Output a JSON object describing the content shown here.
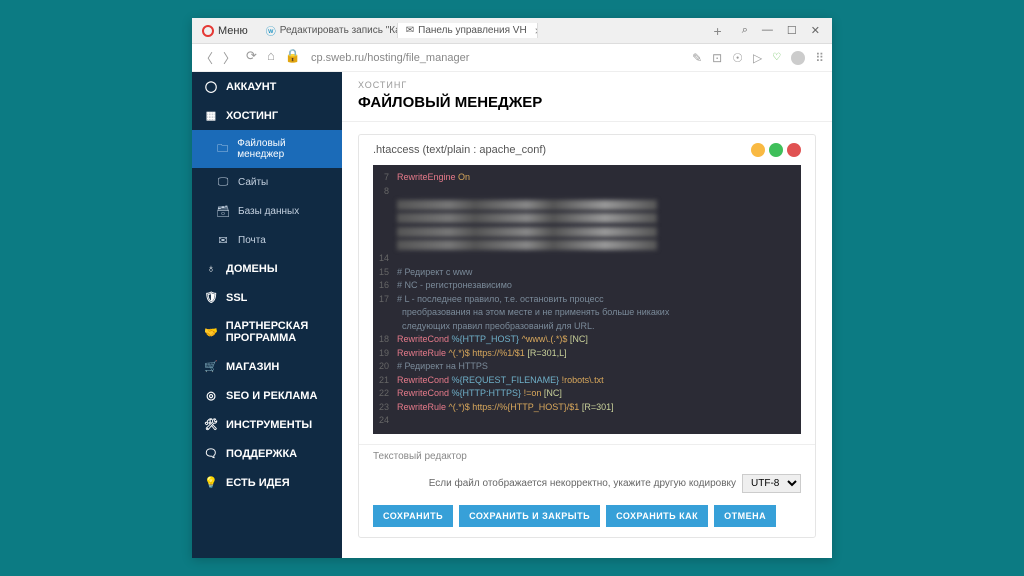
{
  "browser": {
    "menu_label": "Меню",
    "tabs": [
      {
        "label": "Редактировать запись \"Ка...",
        "icon": "wp",
        "active": false
      },
      {
        "label": "Панель управления VH",
        "icon": "mail",
        "active": true
      }
    ],
    "address": "cp.sweb.ru/hosting/file_manager"
  },
  "sidebar": {
    "items": [
      {
        "label": "АККАУНТ",
        "bold": true,
        "icon": "user"
      },
      {
        "label": "ХОСТИНГ",
        "bold": true,
        "icon": "grid"
      },
      {
        "label": "Файловый менеджер",
        "sub": true,
        "active": true,
        "icon": "folder"
      },
      {
        "label": "Сайты",
        "sub": true,
        "icon": "monitor"
      },
      {
        "label": "Базы данных",
        "sub": true,
        "icon": "db"
      },
      {
        "label": "Почта",
        "sub": true,
        "icon": "mail"
      },
      {
        "label": "ДОМЕНЫ",
        "bold": true,
        "icon": "globe"
      },
      {
        "label": "SSL",
        "bold": true,
        "icon": "shield"
      },
      {
        "label": "ПАРТНЕРСКАЯ ПРОГРАММА",
        "bold": true,
        "icon": "hands"
      },
      {
        "label": "МАГАЗИН",
        "bold": true,
        "icon": "cart"
      },
      {
        "label": "SEO И РЕКЛАМА",
        "bold": true,
        "icon": "target"
      },
      {
        "label": "ИНСТРУМЕНТЫ",
        "bold": true,
        "icon": "wrench"
      },
      {
        "label": "ПОДДЕРЖКА",
        "bold": true,
        "icon": "chat"
      },
      {
        "label": "ЕСТЬ ИДЕЯ",
        "bold": true,
        "icon": "bulb"
      }
    ]
  },
  "content": {
    "breadcrumb": "ХОСТИНГ",
    "title": "ФАЙЛОВЫЙ МЕНЕДЖЕР",
    "file_header": ".htaccess (text/plain : apache_conf)",
    "code_lines": [
      {
        "n": "7",
        "html": "<span class='kw'>RewriteEngine</span> <span class='str'>On</span>"
      },
      {
        "n": "8",
        "html": ""
      },
      {
        "n": "",
        "html": "<span class='blur'></span>"
      },
      {
        "n": "",
        "html": "<span class='blur'></span>"
      },
      {
        "n": "",
        "html": "<span class='blur'></span>"
      },
      {
        "n": "",
        "html": "<span class='blur'></span>"
      },
      {
        "n": "14",
        "html": ""
      },
      {
        "n": "15",
        "html": "<span class='cm'># Редирект с www</span>"
      },
      {
        "n": "16",
        "html": "<span class='cm'># NC - регистронезависимо</span>"
      },
      {
        "n": "17",
        "html": "<span class='cm'># L - последнее правило, т.е. остановить процесс</span>"
      },
      {
        "n": "",
        "html": "<span class='cm'>  преобразования на этом месте и не применять больше никаких</span>"
      },
      {
        "n": "",
        "html": "<span class='cm'>  следующих правил преобразований для URL.</span>"
      },
      {
        "n": "18",
        "html": "<span class='kw'>RewriteCond</span> <span class='var'>%{HTTP_HOST}</span> <span class='str'>^www\\.(.*)$</span> <span class='flg'>[NC]</span>"
      },
      {
        "n": "19",
        "html": "<span class='kw'>RewriteRule</span> <span class='str'>^(.*)$ https://%1/$1</span> <span class='flg'>[R=301,L]</span>"
      },
      {
        "n": "20",
        "html": "<span class='cm'># Редирект на HTTPS</span>"
      },
      {
        "n": "21",
        "html": "<span class='kw'>RewriteCond</span> <span class='var'>%{REQUEST_FILENAME}</span> <span class='str'>!robots\\.txt</span>"
      },
      {
        "n": "22",
        "html": "<span class='kw'>RewriteCond</span> <span class='var'>%{HTTP:HTTPS}</span> <span class='str'>!=on</span> <span class='flg'>[NC]</span>"
      },
      {
        "n": "23",
        "html": "<span class='kw'>RewriteRule</span> <span class='str'>^(.*)$ https://%{HTTP_HOST}/$1</span> <span class='flg'>[R=301]</span>"
      },
      {
        "n": "24",
        "html": ""
      }
    ],
    "section_label": "Текстовый редактор",
    "encoding_hint": "Если файл отображается некорректно, укажите другую кодировку",
    "encoding_value": "UTF-8",
    "buttons": {
      "save": "СОХРАНИТЬ",
      "save_close": "СОХРАНИТЬ И ЗАКРЫТЬ",
      "save_as": "СОХРАНИТЬ КАК",
      "cancel": "ОТМЕНА"
    }
  }
}
